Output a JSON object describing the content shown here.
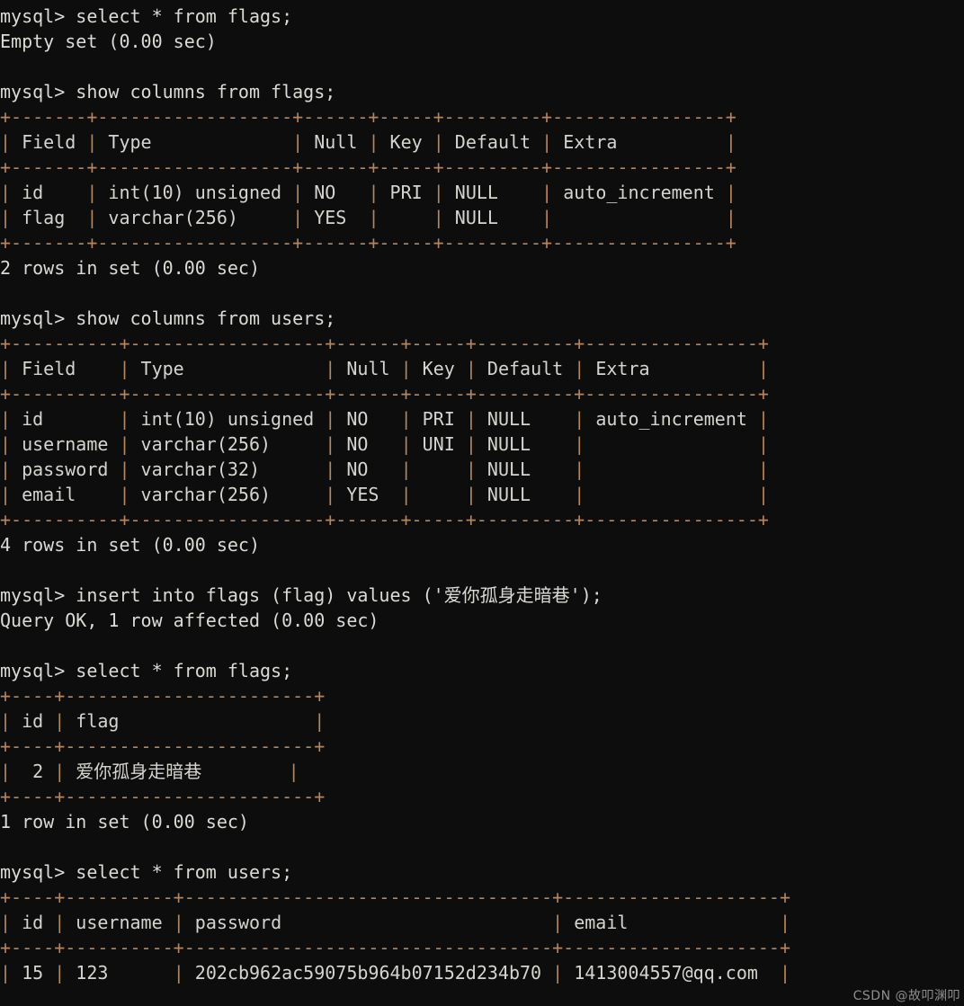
{
  "terminal": {
    "prompt": "mysql>",
    "background_color": "#0d0d0d",
    "text_color": "#d6d4cf",
    "border_color": "#b5855c",
    "lines": [
      "mysql> select * from flags;",
      "Empty set (0.00 sec)",
      "",
      "mysql> show columns from flags;",
      "+-------+------------------+------+-----+---------+----------------+",
      "| Field | Type             | Null | Key | Default | Extra          |",
      "+-------+------------------+------+-----+---------+----------------+",
      "| id    | int(10) unsigned | NO   | PRI | NULL    | auto_increment |",
      "| flag  | varchar(256)     | YES  |     | NULL    |                |",
      "+-------+------------------+------+-----+---------+----------------+",
      "2 rows in set (0.00 sec)",
      "",
      "mysql> show columns from users;",
      "+----------+------------------+------+-----+---------+----------------+",
      "| Field    | Type             | Null | Key | Default | Extra          |",
      "+----------+------------------+------+-----+---------+----------------+",
      "| id       | int(10) unsigned | NO   | PRI | NULL    | auto_increment |",
      "| username | varchar(256)     | NO   | UNI | NULL    |                |",
      "| password | varchar(32)      | NO   |     | NULL    |                |",
      "| email    | varchar(256)     | YES  |     | NULL    |                |",
      "+----------+------------------+------+-----+---------+----------------+",
      "4 rows in set (0.00 sec)",
      "",
      "mysql> insert into flags (flag) values ('爱你孤身走暗巷');",
      "Query OK, 1 row affected (0.00 sec)",
      "",
      "mysql> select * from flags;",
      "+----+-----------------------+",
      "| id | flag                  |",
      "+----+-----------------------+",
      "|  2 | 爱你孤身走暗巷        |",
      "+----+-----------------------+",
      "1 row in set (0.00 sec)",
      "",
      "mysql> select * from users;",
      "+----+----------+----------------------------------+--------------------+",
      "| id | username | password                         | email              |",
      "+----+----------+----------------------------------+--------------------+",
      "| 15 | 123      | 202cb962ac59075b964b07152d234b70 | 1413004557@qq.com  |"
    ],
    "commands": [
      "select * from flags;",
      "show columns from flags;",
      "show columns from users;",
      "insert into flags (flag) values ('爱你孤身走暗巷');",
      "select * from flags;",
      "select * from users;"
    ],
    "status_messages": [
      "Empty set (0.00 sec)",
      "2 rows in set (0.00 sec)",
      "4 rows in set (0.00 sec)",
      "Query OK, 1 row affected (0.00 sec)",
      "1 row in set (0.00 sec)"
    ],
    "tables": [
      {
        "name": "flags-columns",
        "headers": [
          "Field",
          "Type",
          "Null",
          "Key",
          "Default",
          "Extra"
        ],
        "rows": [
          [
            "id",
            "int(10) unsigned",
            "NO",
            "PRI",
            "NULL",
            "auto_increment"
          ],
          [
            "flag",
            "varchar(256)",
            "YES",
            "",
            "NULL",
            ""
          ]
        ],
        "row_count_text": "2 rows in set (0.00 sec)"
      },
      {
        "name": "users-columns",
        "headers": [
          "Field",
          "Type",
          "Null",
          "Key",
          "Default",
          "Extra"
        ],
        "rows": [
          [
            "id",
            "int(10) unsigned",
            "NO",
            "PRI",
            "NULL",
            "auto_increment"
          ],
          [
            "username",
            "varchar(256)",
            "NO",
            "UNI",
            "NULL",
            ""
          ],
          [
            "password",
            "varchar(32)",
            "NO",
            "",
            "NULL",
            ""
          ],
          [
            "email",
            "varchar(256)",
            "YES",
            "",
            "NULL",
            ""
          ]
        ],
        "row_count_text": "4 rows in set (0.00 sec)"
      },
      {
        "name": "flags-rows",
        "headers": [
          "id",
          "flag"
        ],
        "rows": [
          [
            "2",
            "爱你孤身走暗巷"
          ]
        ],
        "row_count_text": "1 row in set (0.00 sec)"
      },
      {
        "name": "users-rows",
        "headers": [
          "id",
          "username",
          "password",
          "email"
        ],
        "rows": [
          [
            "15",
            "123",
            "202cb962ac59075b964b07152d234b70",
            "1413004557@qq.com"
          ]
        ],
        "row_count_text": ""
      }
    ]
  },
  "watermark": {
    "text": "CSDN @故叩渊叩"
  }
}
